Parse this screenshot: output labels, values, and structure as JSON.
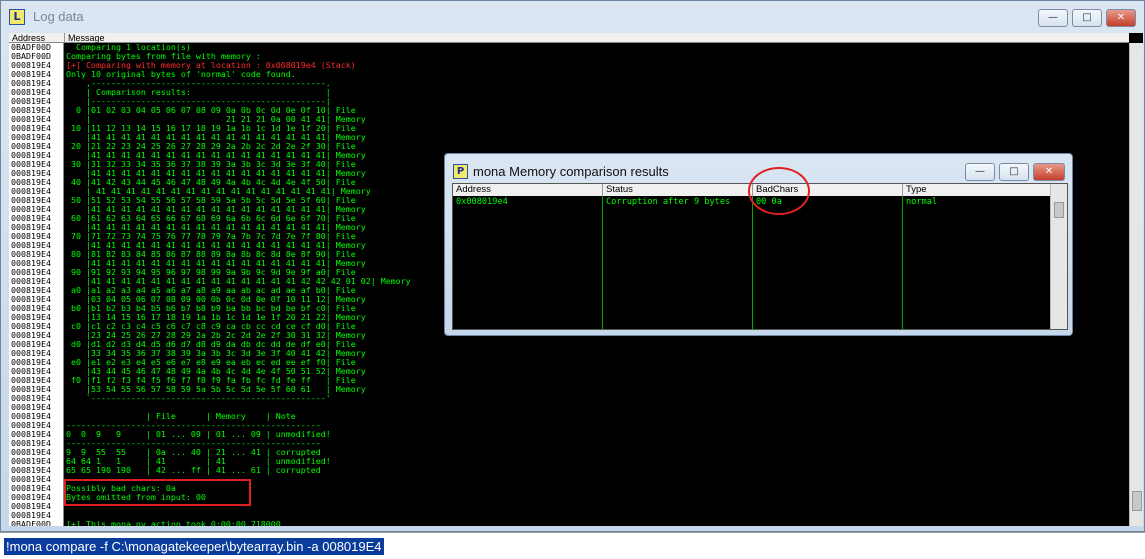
{
  "window": {
    "title": "Log data",
    "app_icon": "L",
    "minimize": "—",
    "maximize": "□",
    "close": "✕"
  },
  "log": {
    "headers": {
      "address": "Address",
      "message": "Message"
    },
    "addresses": [
      "0BADF00D",
      "0BADF00D",
      "000819E4",
      "000819E4",
      "000819E4",
      "000819E4",
      "000819E4",
      "000819E4",
      "000819E4",
      "000819E4",
      "000819E4",
      "000819E4",
      "000819E4",
      "000819E4",
      "000819E4",
      "000819E4",
      "000819E4",
      "000819E4",
      "000819E4",
      "000819E4",
      "000819E4",
      "000819E4",
      "000819E4",
      "000819E4",
      "000819E4",
      "000819E4",
      "000819E4",
      "000819E4",
      "000819E4",
      "000819E4",
      "000819E4",
      "000819E4",
      "000819E4",
      "000819E4",
      "000819E4",
      "000819E4",
      "000819E4",
      "000819E4",
      "000819E4",
      "000819E4",
      "000819E4",
      "000819E4",
      "000819E4",
      "000819E4",
      "000819E4",
      "000819E4",
      "000819E4",
      "000819E4",
      "000819E4",
      "000819E4",
      "000819E4",
      "000819E4",
      "000819E4",
      "0BADF00D"
    ],
    "lines": [
      {
        "text": "  Comparing 1 location(s)",
        "color": "green"
      },
      {
        "text": "Comparing bytes from file with memory :",
        "color": "green"
      },
      {
        "text": "[+] Comparing with memory at location : 0x008019e4 (Stack)",
        "color": "red"
      },
      {
        "text": "Only 10 original bytes of 'normal' code found.",
        "color": "green"
      },
      {
        "text": "    ,-----------------------------------------------.",
        "color": "green"
      },
      {
        "text": "    | Comparison results:                           |",
        "color": "green"
      },
      {
        "text": "    |-----------------------------------------------|",
        "color": "green"
      },
      {
        "text": "  0 |01 02 03 04 05 06 07 08 09 0a 0b 0c 0d 0e 0f 10| File",
        "color": "green"
      },
      {
        "text": "    |                           21 21 21 0a 00 41 41| Memory",
        "color": "green"
      },
      {
        "text": " 10 |11 12 13 14 15 16 17 18 19 1a 1b 1c 1d 1e 1f 20| File",
        "color": "green"
      },
      {
        "text": "    |41 41 41 41 41 41 41 41 41 41 41 41 41 41 41 41| Memory",
        "color": "green"
      },
      {
        "text": " 20 |21 22 23 24 25 26 27 28 29 2a 2b 2c 2d 2e 2f 30| File",
        "color": "green"
      },
      {
        "text": "    |41 41 41 41 41 41 41 41 41 41 41 41 41 41 41 41| Memory",
        "color": "green"
      },
      {
        "text": " 30 |31 32 33 34 35 36 37 38 39 3a 3b 3c 3d 3e 3f 40| File",
        "color": "green"
      },
      {
        "text": "    |41 41 41 41 41 41 41 41 41 41 41 41 41 41 41 41| Memory",
        "color": "green"
      },
      {
        "text": " 40 |41 42 43 44 45 46 47 48 49 4a 4b 4c 4d 4e 4f 50| File",
        "color": "green"
      },
      {
        "text": "    | 41 41 41 41 41 41 41 41 41 41 41 41 41 41 41 41| Memory",
        "color": "green"
      },
      {
        "text": " 50 |51 52 53 54 55 56 57 58 59 5a 5b 5c 5d 5e 5f 60| File",
        "color": "green"
      },
      {
        "text": "    |41 41 41 41 41 41 41 41 41 41 41 41 41 41 41 41| Memory",
        "color": "green"
      },
      {
        "text": " 60 |61 62 63 64 65 66 67 68 69 6a 6b 6c 6d 6e 6f 70| File",
        "color": "green"
      },
      {
        "text": "    |41 41 41 41 41 41 41 41 41 41 41 41 41 41 41 41| Memory",
        "color": "green"
      },
      {
        "text": " 70 |71 72 73 74 75 76 77 78 79 7a 7b 7c 7d 7e 7f 80| File",
        "color": "green"
      },
      {
        "text": "    |41 41 41 41 41 41 41 41 41 41 41 41 41 41 41 41| Memory",
        "color": "green"
      },
      {
        "text": " 80 |81 82 83 84 85 86 87 88 89 8a 8b 8c 8d 8e 8f 90| File",
        "color": "green"
      },
      {
        "text": "    |41 41 41 41 41 41 41 41 41 41 41 41 41 41 41 41| Memory",
        "color": "green"
      },
      {
        "text": " 90 |91 92 93 94 95 96 97 98 99 9a 9b 9c 9d 9e 9f a0| File",
        "color": "green"
      },
      {
        "text": "    |41 41 41 41 41 41 41 41 41 41 41 41 41 41 42 42 42 01 02| Memory",
        "color": "green"
      },
      {
        "text": " a0 |a1 a2 a3 a4 a5 a6 a7 a8 a9 aa ab ac ad ae af b0| File",
        "color": "green"
      },
      {
        "text": "    |03 04 05 06 07 08 09 00 0b 0c 0d 0e 0f 10 11 12| Memory",
        "color": "green"
      },
      {
        "text": " b0 |b1 b2 b3 b4 b5 b6 b7 b8 b9 ba bb bc bd be bf c0| File",
        "color": "green"
      },
      {
        "text": "    |13 14 15 16 17 18 19 1a 1b 1c 1d 1e 1f 20 21 22| Memory",
        "color": "green"
      },
      {
        "text": " c0 |c1 c2 c3 c4 c5 c6 c7 c8 c9 ca cb cc cd ce cf d0| File",
        "color": "green"
      },
      {
        "text": "    |23 24 25 26 27 28 29 2a 2b 2c 2d 2e 2f 30 31 32| Memory",
        "color": "green"
      },
      {
        "text": " d0 |d1 d2 d3 d4 d5 d6 d7 d8 d9 da db dc dd de df e0| File",
        "color": "green"
      },
      {
        "text": "    |33 34 35 36 37 38 39 3a 3b 3c 3d 3e 3f 40 41 42| Memory",
        "color": "green"
      },
      {
        "text": " e0 |e1 e2 e3 e4 e5 e6 e7 e8 e9 ea eb ec ed ee ef f0| File",
        "color": "green"
      },
      {
        "text": "    |43 44 45 46 47 48 49 4a 4b 4c 4d 4e 4f 50 51 52| Memory",
        "color": "green"
      },
      {
        "text": " f0 |f1 f2 f3 f4 f5 f6 f7 f8 f9 fa fb fc fd fe ff   | File",
        "color": "green"
      },
      {
        "text": "    |53 54 55 56 57 58 59 5a 5b 5c 5d 5e 5f 60 61   | Memory",
        "color": "green"
      },
      {
        "text": "    `-----------------------------------------------'",
        "color": "green"
      },
      {
        "text": "",
        "color": "green"
      },
      {
        "text": "                | File      | Memory    | Note",
        "color": "green"
      },
      {
        "text": "---------------------------------------------------",
        "color": "green"
      },
      {
        "text": "0  0  9   9     | 01 ... 09 | 01 ... 09 | unmodified!",
        "color": "green"
      },
      {
        "text": "---------------------------------------------------",
        "color": "green"
      },
      {
        "text": "9  9  55  55    | 0a ... 40 | 21 ... 41 | corrupted",
        "color": "green"
      },
      {
        "text": "64 64 1   1     | 41        | 41        | unmodified!",
        "color": "green"
      },
      {
        "text": "65 65 190 190   | 42 ... ff | 41 ... 61 | corrupted",
        "color": "green"
      },
      {
        "text": "",
        "color": "green"
      },
      {
        "text": "Possibly bad chars: 0a",
        "color": "green"
      },
      {
        "text": "Bytes omitted from input: 00",
        "color": "green"
      },
      {
        "text": "",
        "color": "green"
      },
      {
        "text": "",
        "color": "green"
      },
      {
        "text": "[+] This mona.py action took 0:00:00.718000",
        "color": "green"
      }
    ]
  },
  "command": {
    "value": "!mona compare -f C:\\monagatekeeper\\bytearray.bin -a 008019E4"
  },
  "popup": {
    "title": "mona Memory comparison results",
    "app_icon": "P",
    "minimize": "—",
    "maximize": "□",
    "close": "✕",
    "columns": [
      "Address",
      "Status",
      "BadChars",
      "Type"
    ],
    "row": {
      "address": "0x008019e4",
      "status": "Corruption after 9 bytes",
      "badchars": "00 0a",
      "type": "normal"
    }
  },
  "colors": {
    "green": "#00ff00",
    "red": "#ff2a2a",
    "highlight": "#e02020"
  }
}
